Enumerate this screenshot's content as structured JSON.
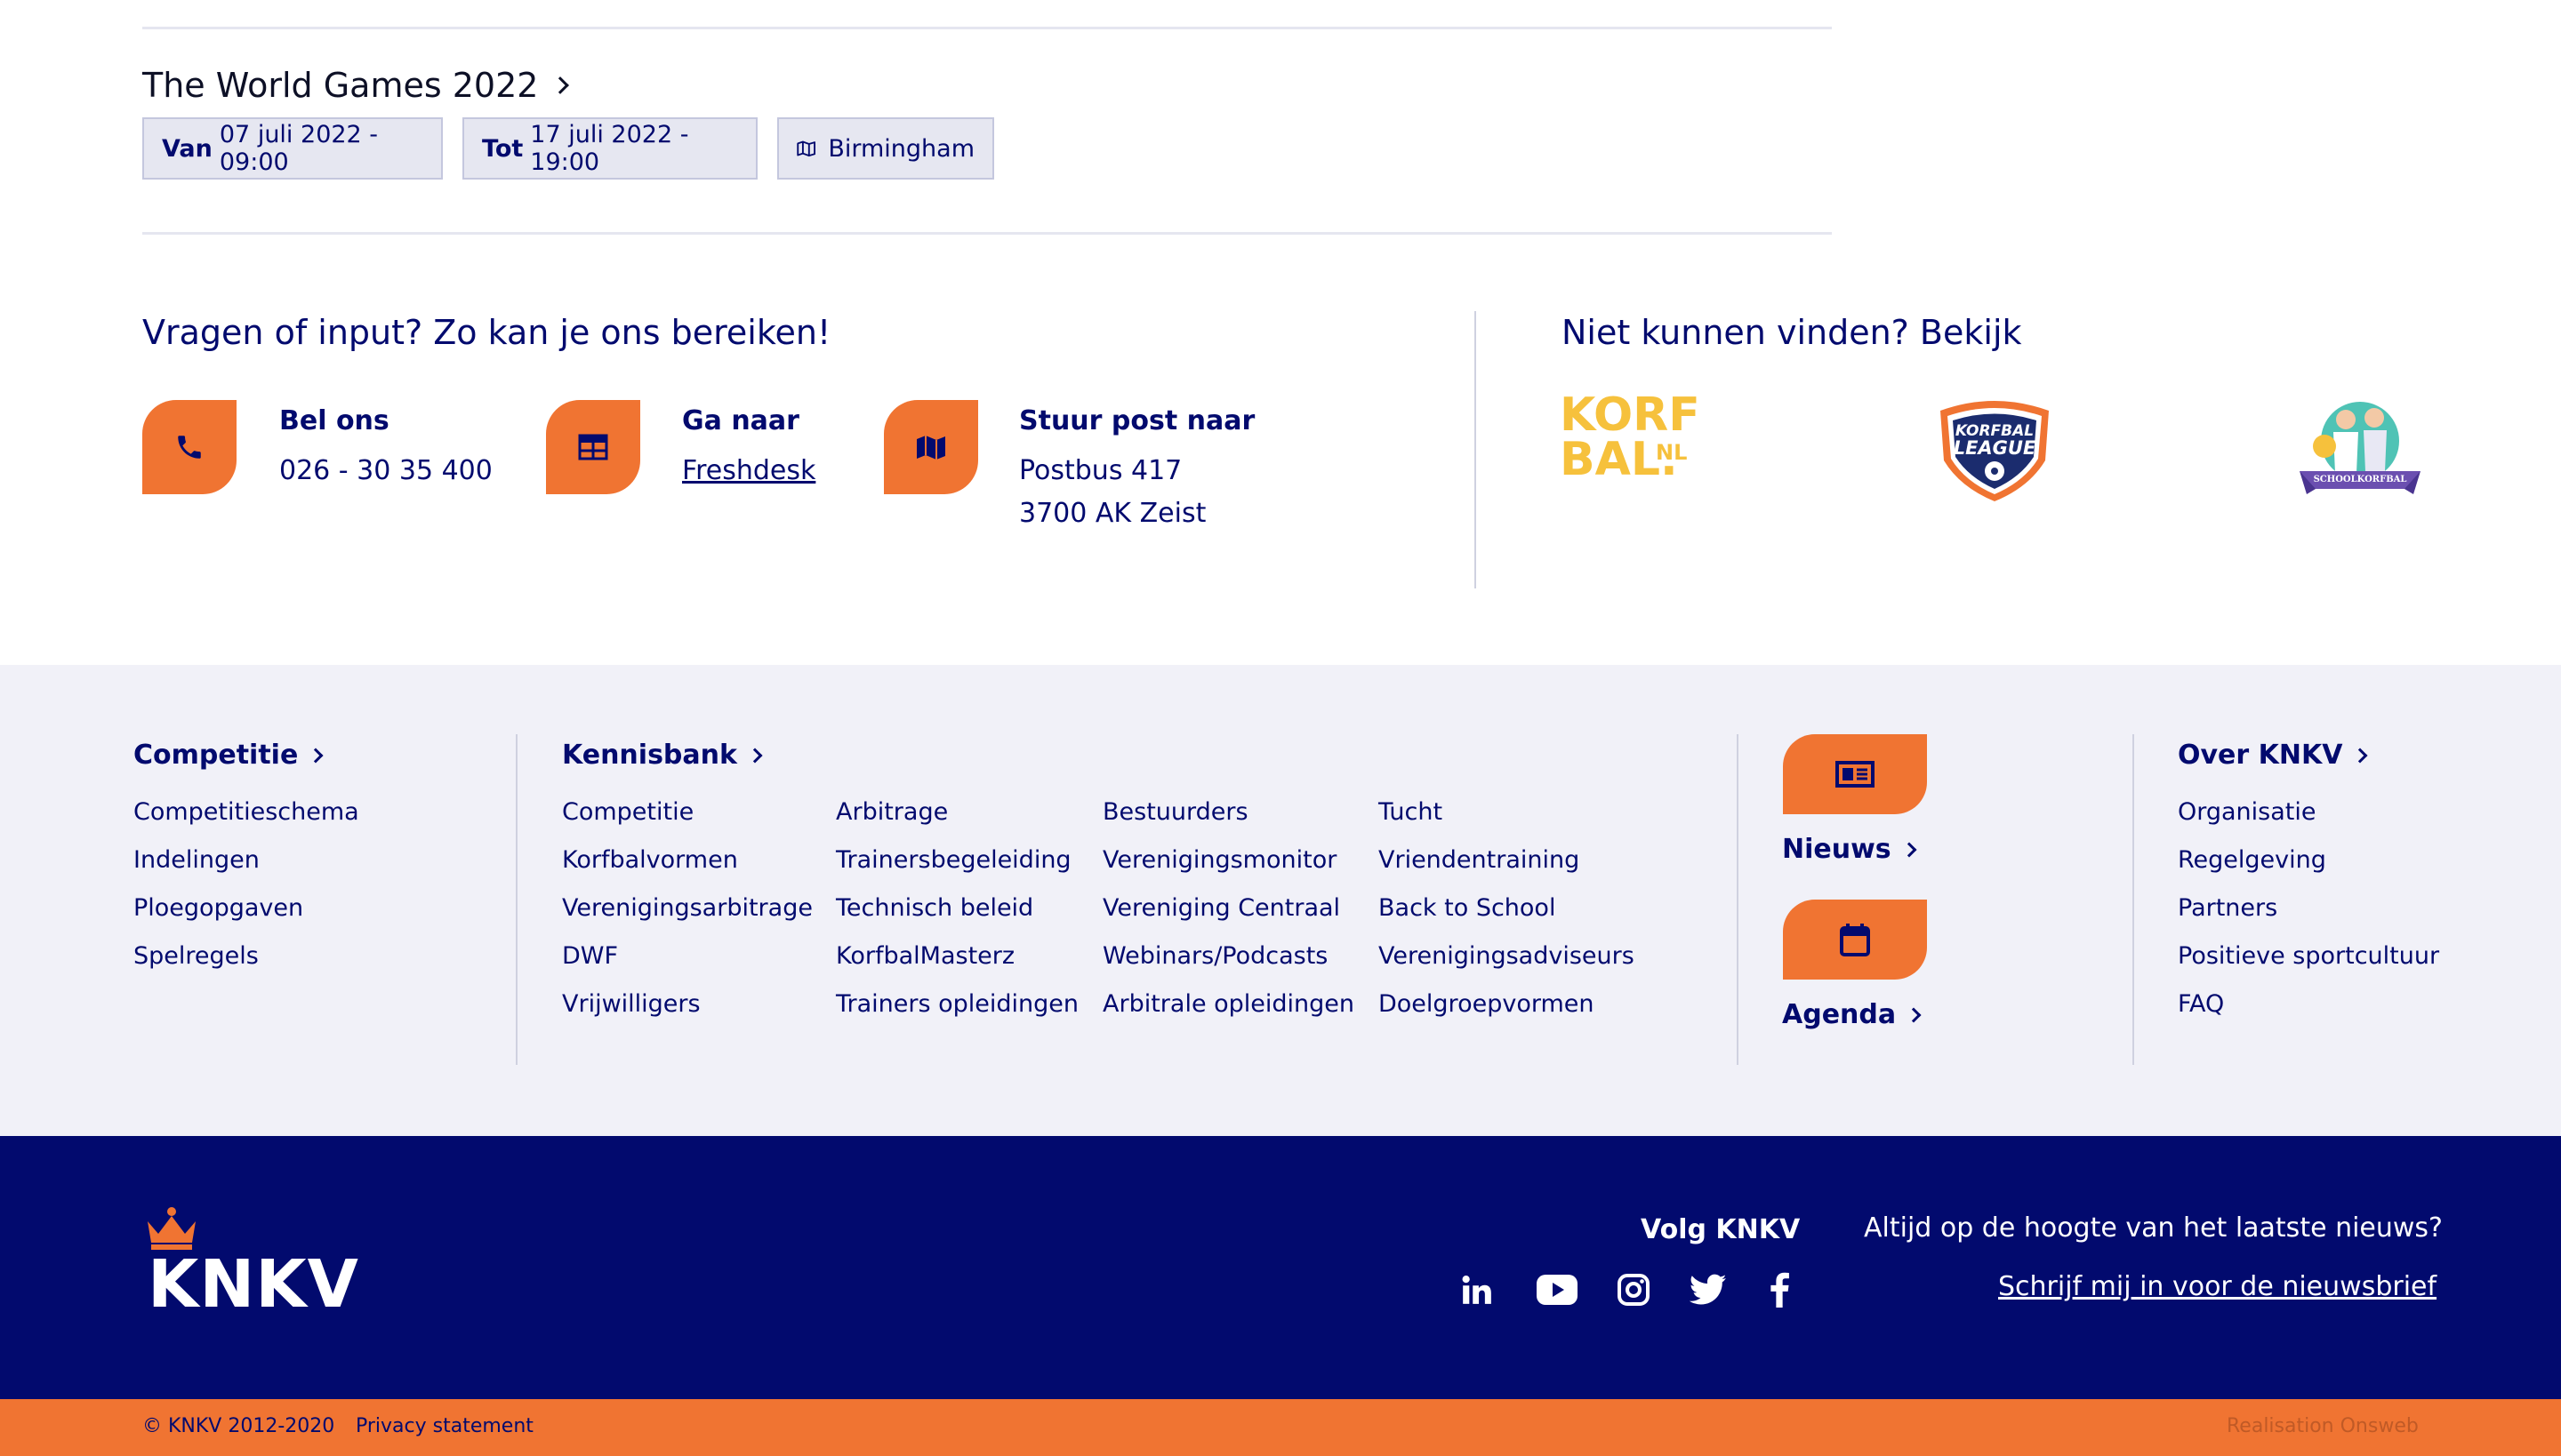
{
  "event": {
    "title": "The World Games 2022",
    "from_label": "Van",
    "from_value": "07 juli 2022 - 09:00",
    "to_label": "Tot",
    "to_value": "17 juli 2022 - 19:00",
    "location": "Birmingham"
  },
  "contact": {
    "heading": "Vragen of input? Zo kan je ons bereiken!",
    "phone_label": "Bel ons",
    "phone_value": "026 - 30 35 400",
    "goto_label": "Ga naar",
    "goto_link": "Freshdesk",
    "post_label": "Stuur post naar",
    "post_line1": "Postbus 417",
    "post_line2": "3700 AK Zeist"
  },
  "partners": {
    "heading": "Niet kunnen vinden? Bekijk",
    "korfbal_logo_text1": "KORF",
    "korfbal_logo_text2": "BAL.",
    "korfbal_logo_suffix": "NL",
    "league_logo_text1": "KORFBAL",
    "league_logo_text2": "LEAGUE",
    "school_logo_text": "SCHOOLKORFBAL"
  },
  "footer": {
    "competitie": {
      "heading": "Competitie",
      "links": [
        "Competitieschema",
        "Indelingen",
        "Ploegopgaven",
        "Spelregels"
      ]
    },
    "kennisbank": {
      "heading": "Kennisbank",
      "col1": [
        "Competitie",
        "Korfbalvormen",
        "Verenigingsarbitrage",
        "DWF",
        "Vrijwilligers"
      ],
      "col2": [
        "Arbitrage",
        "Trainersbegeleiding",
        "Technisch beleid",
        "KorfbalMasterz",
        "Trainers opleidingen"
      ],
      "col3": [
        "Bestuurders",
        "Verenigingsmonitor",
        "Vereniging Centraal",
        "Webinars/Podcasts",
        "Arbitrale opleidingen"
      ],
      "col4": [
        "Tucht",
        "Vriendentraining",
        "Back to School",
        "Verenigingsadviseurs",
        "Doelgroepvormen"
      ]
    },
    "nieuws_label": "Nieuws",
    "agenda_label": "Agenda",
    "over": {
      "heading": "Over KNKV",
      "links": [
        "Organisatie",
        "Regelgeving",
        "Partners",
        "Positieve sportcultuur",
        "FAQ"
      ]
    }
  },
  "main_footer": {
    "logo_text": "KNKV",
    "follow_label": "Volg KNKV",
    "social": [
      "linkedin-icon",
      "youtube-icon",
      "instagram-icon",
      "twitter-icon",
      "facebook-icon"
    ],
    "newsletter_question": "Altijd op de hoogte van het laatste nieuws?",
    "newsletter_link": "Schrijf mij in voor de nieuwsbrief"
  },
  "bottom_bar": {
    "copyright": "© KNKV 2012-2020",
    "privacy": "Privacy statement",
    "realisation": "Realisation Onsweb"
  },
  "colors": {
    "navy": "#020a6e",
    "orange": "#f07432",
    "light_bg": "#f1f1f8"
  }
}
